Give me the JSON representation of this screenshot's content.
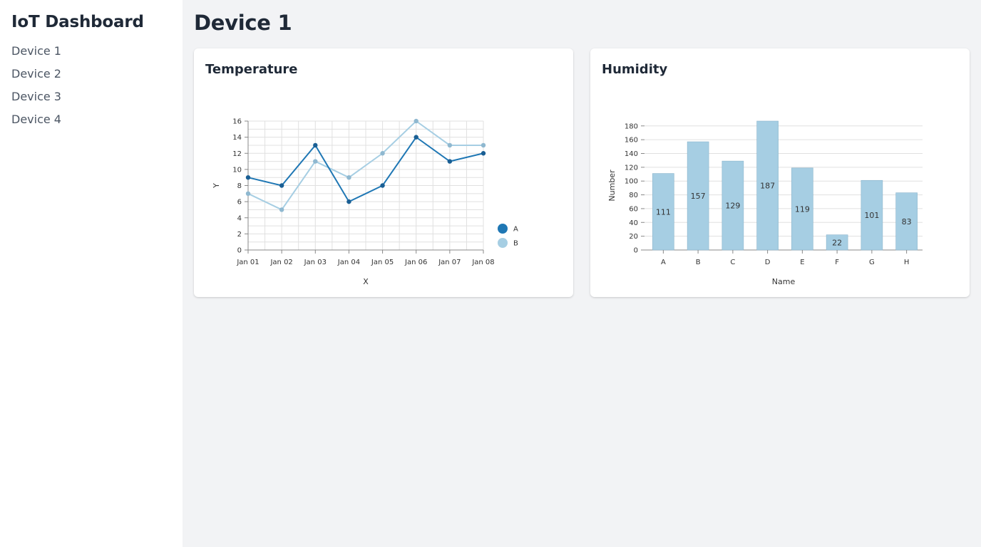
{
  "sidebar": {
    "title": "IoT Dashboard",
    "items": [
      {
        "label": "Device 1"
      },
      {
        "label": "Device 2"
      },
      {
        "label": "Device 3"
      },
      {
        "label": "Device 4"
      }
    ]
  },
  "main": {
    "title": "Device 1"
  },
  "cards": {
    "temperature": {
      "title": "Temperature"
    },
    "humidity": {
      "title": "Humidity"
    }
  },
  "colors": {
    "series_a": "#1f77b4",
    "series_b": "#a6cee3",
    "bar_fill": "#a6cee3",
    "grid": "#e0e0e0"
  },
  "chart_data": [
    {
      "type": "line",
      "title": "",
      "xlabel": "X",
      "ylabel": "Y",
      "x": [
        "Jan 01",
        "Jan 02",
        "Jan 03",
        "Jan 04",
        "Jan 05",
        "Jan 06",
        "Jan 07",
        "Jan 08"
      ],
      "ylim": [
        0,
        16
      ],
      "yticks": [
        0,
        2,
        4,
        6,
        8,
        10,
        12,
        14,
        16
      ],
      "grid": true,
      "legend": "right",
      "series": [
        {
          "name": "A",
          "color": "#1f77b4",
          "values": [
            9,
            8,
            13,
            6,
            8,
            14,
            11,
            12
          ]
        },
        {
          "name": "B",
          "color": "#a6cee3",
          "values": [
            7,
            5,
            11,
            9,
            12,
            16,
            13,
            13
          ]
        }
      ]
    },
    {
      "type": "bar",
      "title": "",
      "xlabel": "Name",
      "ylabel": "Number",
      "categories": [
        "A",
        "B",
        "C",
        "D",
        "E",
        "F",
        "G",
        "H"
      ],
      "values": [
        111,
        157,
        129,
        187,
        119,
        22,
        101,
        83
      ],
      "ylim": [
        0,
        187
      ],
      "yticks": [
        0,
        20,
        40,
        60,
        80,
        100,
        120,
        140,
        160,
        180
      ],
      "grid": true
    }
  ]
}
